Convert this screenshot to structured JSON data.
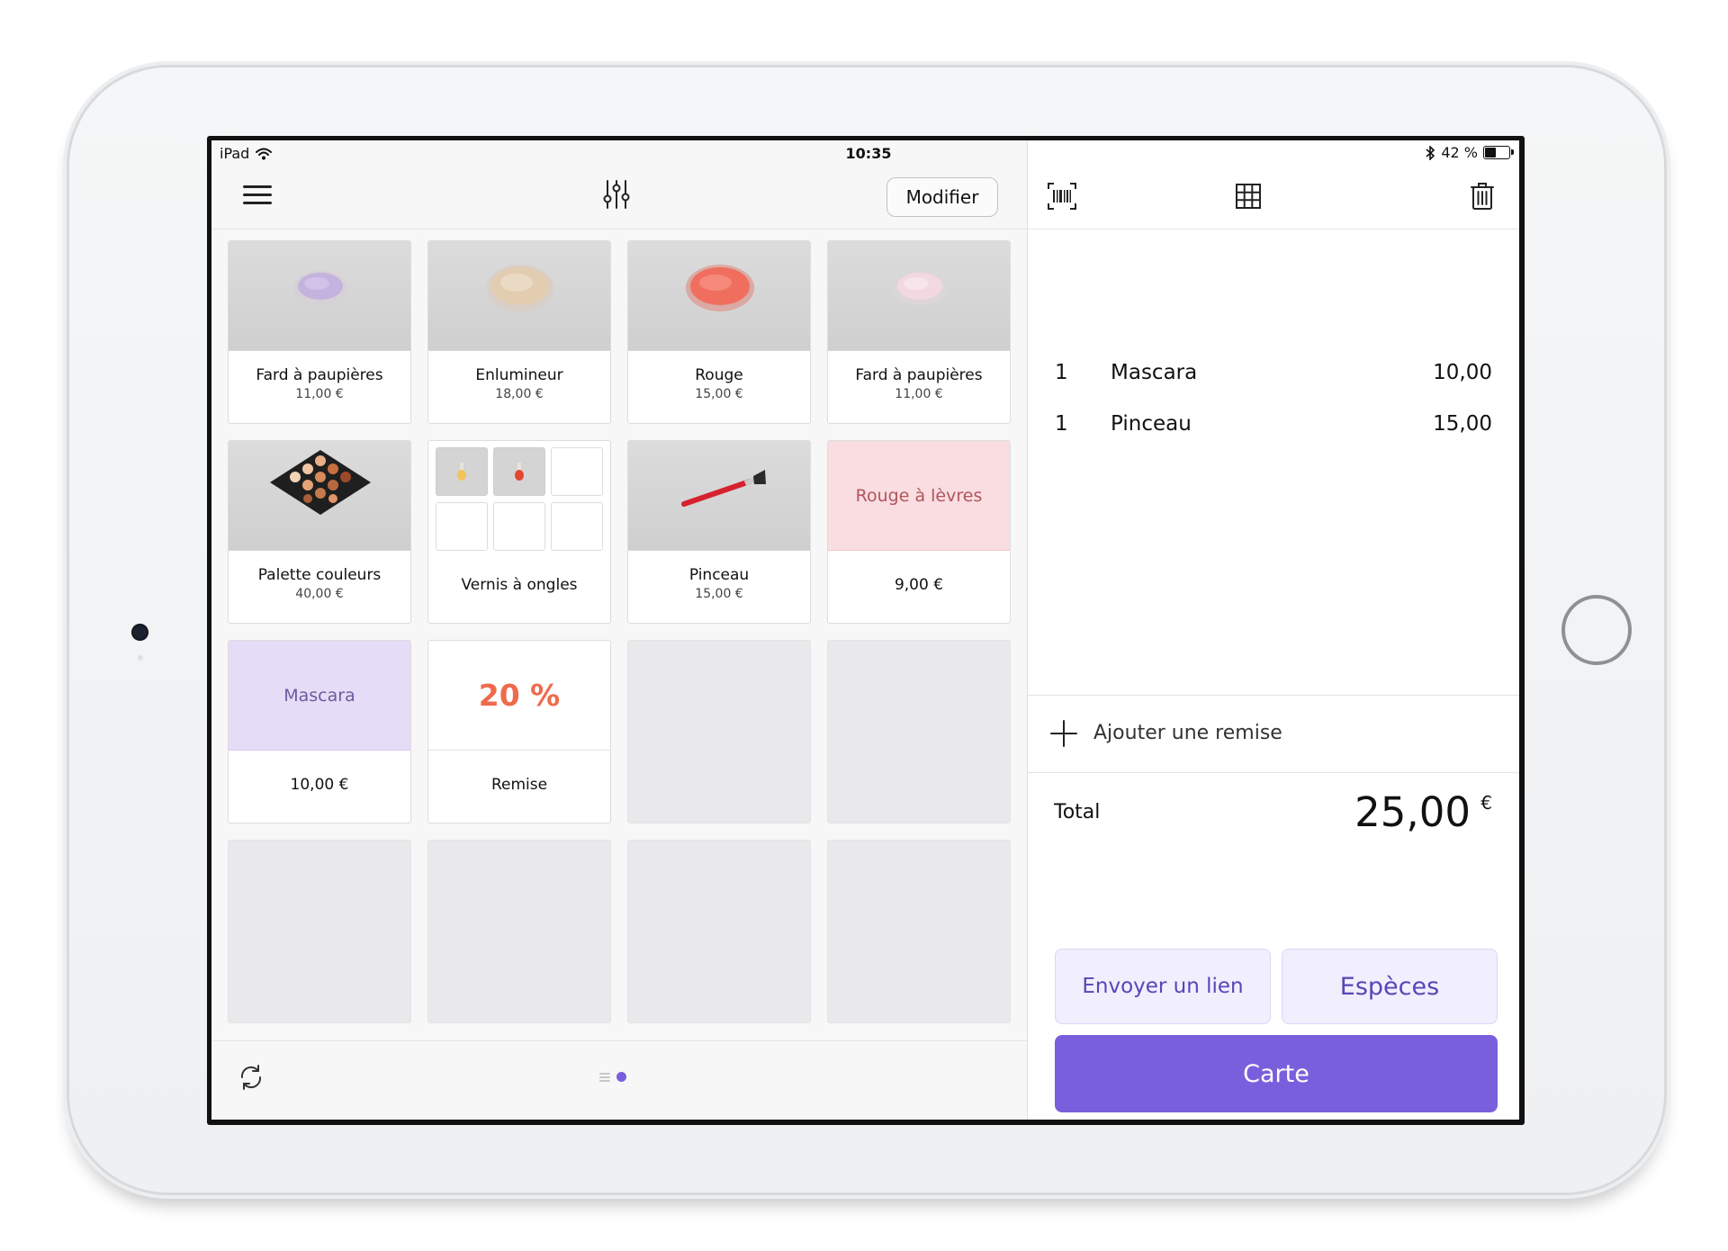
{
  "status_bar": {
    "device": "iPad",
    "time": "10:35",
    "battery_text": "42 %",
    "battery_level": 0.42
  },
  "toolbar": {
    "modify_label": "Modifier"
  },
  "products": [
    {
      "name": "Fard à paupières",
      "price": "11,00 €",
      "image": "lilac-eyeshadow-pan"
    },
    {
      "name": "Enlumineur",
      "price": "18,00 €",
      "image": "beige-highlighter-pan"
    },
    {
      "name": "Rouge",
      "price": "15,00 €",
      "image": "coral-blush-pan"
    },
    {
      "name": "Fard à paupières",
      "price": "11,00 €",
      "image": "pink-eyeshadow-pan"
    },
    {
      "name": "Palette couleurs",
      "price": "40,00 €",
      "image": "color-palette"
    },
    {
      "name": "Vernis à ongles",
      "image": "nail-polish-group"
    },
    {
      "name": "Pinceau",
      "price": "15,00 €",
      "image": "red-brush"
    },
    {
      "name": "Rouge à lèvres",
      "price": "9,00 €",
      "color": "#f9dde0",
      "text_color": "#b0555e"
    },
    {
      "name": "Mascara",
      "price": "10,00 €",
      "color": "#e5dcf7",
      "text_color": "#6f5a9e"
    },
    {
      "name": "Remise",
      "badge": "20 %",
      "badge_color": "#ef6a4c"
    }
  ],
  "cart": {
    "lines": [
      {
        "qty": "1",
        "item": "Mascara",
        "amount": "10,00"
      },
      {
        "qty": "1",
        "item": "Pinceau",
        "amount": "15,00"
      }
    ],
    "add_discount_label": "Ajouter une remise",
    "total_label": "Total",
    "total_value": "25,00",
    "currency": "€"
  },
  "payment": {
    "send_link": "Envoyer un lien",
    "cash": "Espèces",
    "card": "Carte"
  },
  "colors": {
    "accent": "#7a5fdc",
    "accent_light": "#f1eefd",
    "discount_orange": "#ef6a4c"
  },
  "pager": {
    "current_page": 2
  }
}
